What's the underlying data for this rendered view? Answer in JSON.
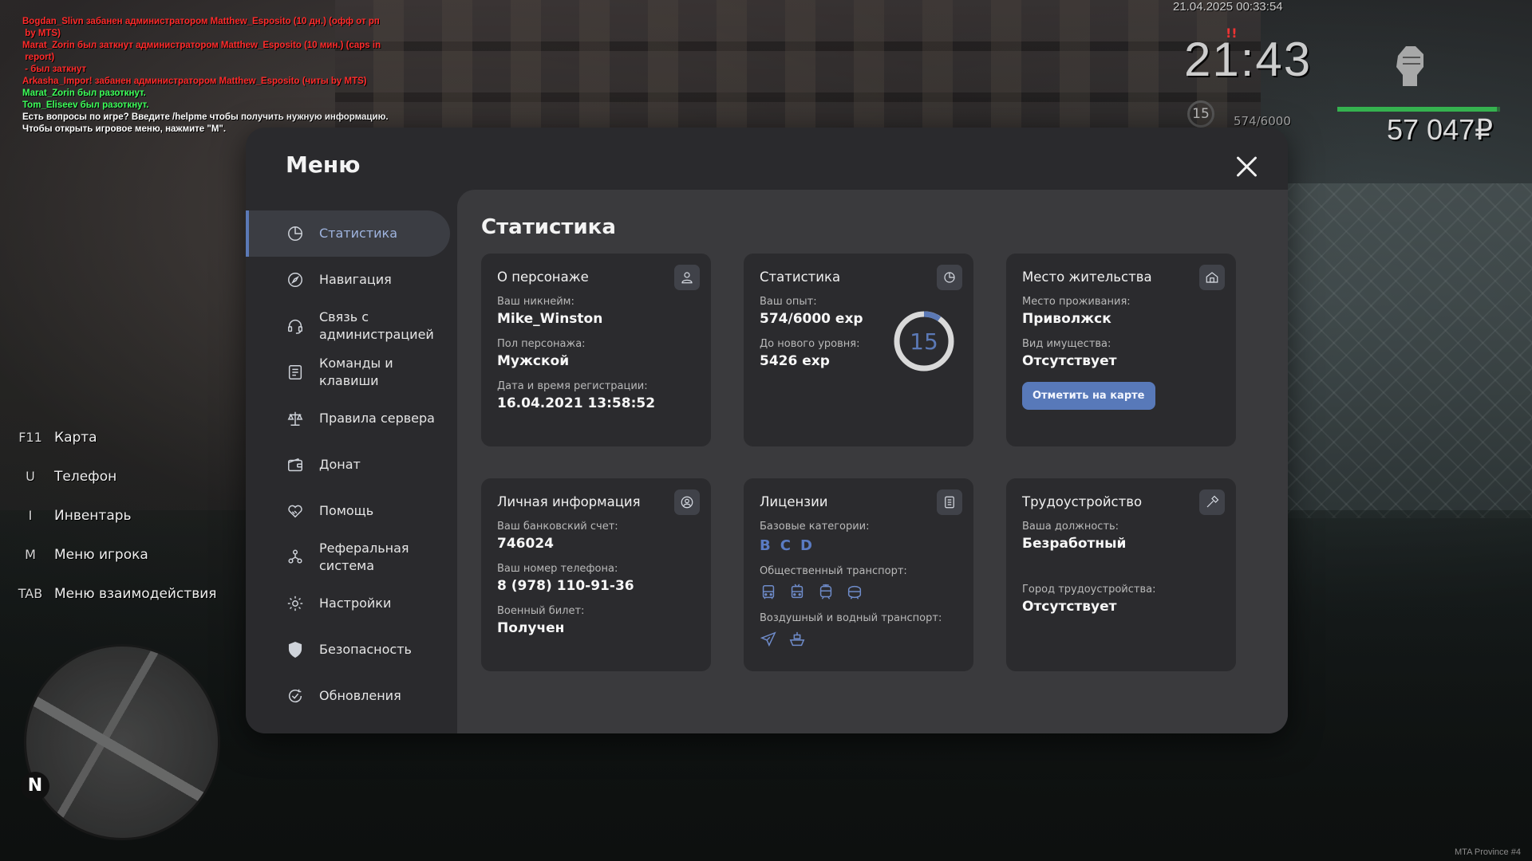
{
  "chat": [
    {
      "text": "Bogdan_Slivn забанен администратором Matthew_Esposito (10 дн.) (офф от рп\n by MTS)",
      "color": "#ff2b2b"
    },
    {
      "text": "Marat_Zorin был заткнут администратором Matthew_Esposito (10 мин.) (caps in\n report)",
      "color": "#ff2b2b"
    },
    {
      "text": " - был заткнут",
      "color": "#ff2b2b"
    },
    {
      "text": "Arkasha_Impor! забанен администратором Matthew_Esposito (читы by MTS)",
      "color": "#ff2b2b"
    },
    {
      "text": "Marat_Zorin был разоткнут.",
      "color": "#3dff5a"
    },
    {
      "text": "Tom_Eliseev был разоткнут.",
      "color": "#3dff5a"
    },
    {
      "text": "Есть вопросы по игре? Введите /helpme чтобы получить нужную информацию.",
      "color": "#ffffff"
    },
    {
      "text": "Чтобы открыть игровое меню, нажмите \"M\".",
      "color": "#ffffff"
    }
  ],
  "hud": {
    "datetime": "21.04.2025 00:33:54",
    "clock": "21:43",
    "alert": "!!",
    "level": "15",
    "exp": "574/6000",
    "money": "57 047₽",
    "health_fraction": 0.98,
    "health_color": "#35b24f"
  },
  "hotkeys": [
    {
      "key": "F11",
      "label": "Карта"
    },
    {
      "key": "U",
      "label": "Телефон"
    },
    {
      "key": "I",
      "label": "Инвентарь"
    },
    {
      "key": "M",
      "label": "Меню игрока"
    },
    {
      "key": "TAB",
      "label": "Меню взаимодействия"
    }
  ],
  "minimap": {
    "north": "N"
  },
  "watermark": "MTA Province #4",
  "menu": {
    "title": "Меню",
    "close_icon": "close-icon",
    "sidebar": [
      {
        "label": "Статистика",
        "icon": "pie-chart-icon",
        "active": true
      },
      {
        "label": "Навигация",
        "icon": "compass-icon"
      },
      {
        "label": "Связь с\nадминистрацией",
        "icon": "headset-icon"
      },
      {
        "label": "Команды и\nклавиши",
        "icon": "document-list-icon"
      },
      {
        "label": "Правила сервера",
        "icon": "scales-icon"
      },
      {
        "label": "Донат",
        "icon": "wallet-icon"
      },
      {
        "label": "Помощь",
        "icon": "handshake-heart-icon"
      },
      {
        "label": "Реферальная\nсистема",
        "icon": "people-network-icon"
      },
      {
        "label": "Настройки",
        "icon": "gear-icon"
      },
      {
        "label": "Безопасность",
        "icon": "shield-icon"
      },
      {
        "label": "Обновления",
        "icon": "refresh-check-icon"
      }
    ],
    "accent_color": "#5b79b6"
  },
  "stats": {
    "title": "Статистика",
    "character": {
      "title": "О персонаже",
      "nickname_label": "Ваш никнейм:",
      "nickname": "Mike_Winston",
      "gender_label": "Пол персонажа:",
      "gender": "Мужской",
      "reg_label": "Дата и время регистрации:",
      "reg": "16.04.2021 13:58:52"
    },
    "statistics": {
      "title": "Статистика",
      "exp_label": "Ваш опыт:",
      "exp": "574/6000 exp",
      "next_label": "До нового уровня:",
      "next": "5426 exp",
      "level": "15",
      "progress": 0.0957
    },
    "residence": {
      "title": "Место жительства",
      "place_label": "Место проживания:",
      "place": "Приволжск",
      "property_label": "Вид имущества:",
      "property": "Отсутствует",
      "button": "Отметить на карте"
    },
    "personal": {
      "title": "Личная информация",
      "bank_label": "Ваш банковский счет:",
      "bank": "746024",
      "phone_label": "Ваш номер телефона:",
      "phone": "8 (978) 110-91-36",
      "military_label": "Военный билет:",
      "military": "Получен"
    },
    "licenses": {
      "title": "Лицензии",
      "base_label": "Базовые категории:",
      "categories": [
        "B",
        "C",
        "D"
      ],
      "public_label": "Общественный транспорт:",
      "public_icons": [
        "bus-icon",
        "trolleybus-icon",
        "tram-icon",
        "metro-icon"
      ],
      "airwater_label": "Воздушный и водный транспорт:",
      "airwater_icons": [
        "plane-icon",
        "boat-icon"
      ]
    },
    "employment": {
      "title": "Трудоустройство",
      "position_label": "Ваша должность:",
      "position": "Безработный",
      "city_label": "Город трудоустройства:",
      "city": "Отсутствует"
    }
  }
}
